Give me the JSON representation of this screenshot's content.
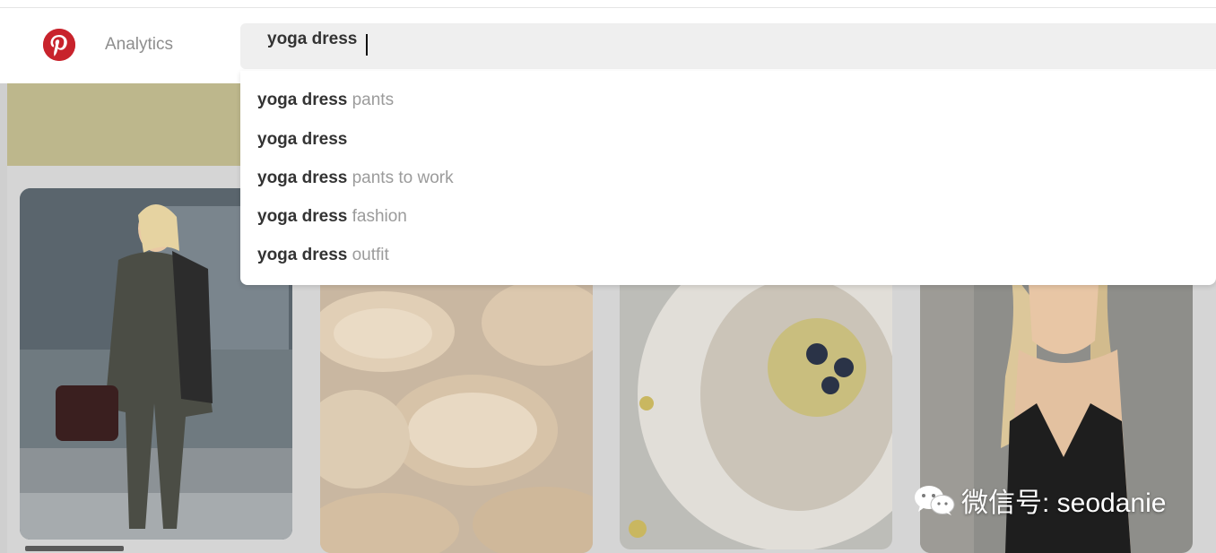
{
  "header": {
    "nav_label": "Analytics",
    "logo_icon": "pinterest-logo-icon",
    "brand_color": "#c8232c"
  },
  "search": {
    "query": "yoga dress"
  },
  "suggestions": [
    {
      "match": "yoga dress",
      "rest": " pants"
    },
    {
      "match": "yoga dress",
      "rest": ""
    },
    {
      "match": "yoga dress",
      "rest": " pants to work"
    },
    {
      "match": "yoga dress",
      "rest": " fashion"
    },
    {
      "match": "yoga dress",
      "rest": " outfit"
    }
  ],
  "feed": {
    "pins": [
      {
        "icon": "woman-in-suit-image"
      },
      {
        "icon": "banana-slices-image"
      },
      {
        "icon": "oatmeal-bowl-image"
      },
      {
        "icon": "woman-in-leather-dress-image"
      }
    ]
  },
  "watermark": {
    "icon": "wechat-icon",
    "text": "微信号: seodanie"
  }
}
